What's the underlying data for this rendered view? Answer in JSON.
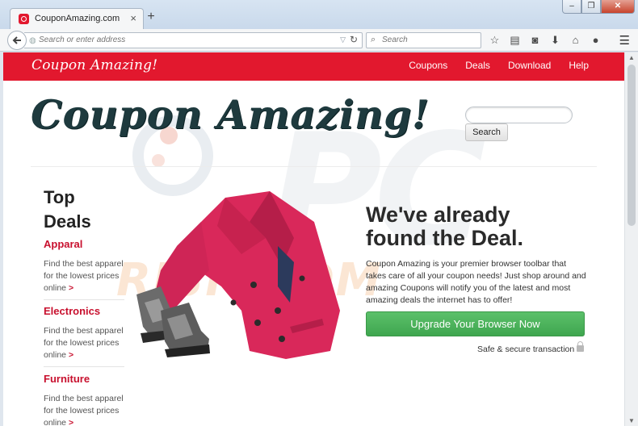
{
  "browser": {
    "tab_title": "CouponAmazing.com",
    "tab_close": "×",
    "new_tab": "+",
    "url_placeholder": "Search or enter address",
    "search_placeholder": "Search",
    "window_minimize": "–",
    "window_maximize": "❐",
    "window_close": "✕",
    "icons": [
      "star-icon",
      "reading-list-icon",
      "pocket-icon",
      "download-icon",
      "home-icon",
      "chat-icon",
      "hamburger-menu-icon"
    ]
  },
  "header": {
    "logo": "Coupon Amazing!",
    "nav": [
      "Coupons",
      "Deals",
      "Download",
      "Help"
    ]
  },
  "hero": {
    "title": "Coupon Amazing!",
    "search_button": "Search"
  },
  "sidebar": {
    "title_line1": "Top",
    "title_line2": "Deals",
    "categories": [
      {
        "name": "Apparal",
        "desc_line1": "Find the best apparel",
        "desc_line2": "for the lowest prices",
        "desc_line3": "online",
        "arrow": ">"
      },
      {
        "name": "Electronics",
        "desc_line1": "Find the best apparel",
        "desc_line2": "for the lowest prices",
        "desc_line3": "online",
        "arrow": ">"
      },
      {
        "name": "Furniture",
        "desc_line1": "Find the best apparel",
        "desc_line2": "for the lowest prices",
        "desc_line3": "online",
        "arrow": ">"
      }
    ]
  },
  "main": {
    "headline_line1": "We've already",
    "headline_line2": "found the Deal.",
    "blurb": "Coupon Amazing is your premier browser toolbar that takes care of all your coupon needs! Just shop around and amazing Coupons will notify you of the latest and most amazing deals the internet has to offer!",
    "cta": "Upgrade Your Browser Now",
    "secure_note": "Safe & secure transaction"
  },
  "colors": {
    "brand_red": "#e2182e",
    "cta_green": "#4cb05a",
    "title_dark": "#1e3a3e"
  }
}
